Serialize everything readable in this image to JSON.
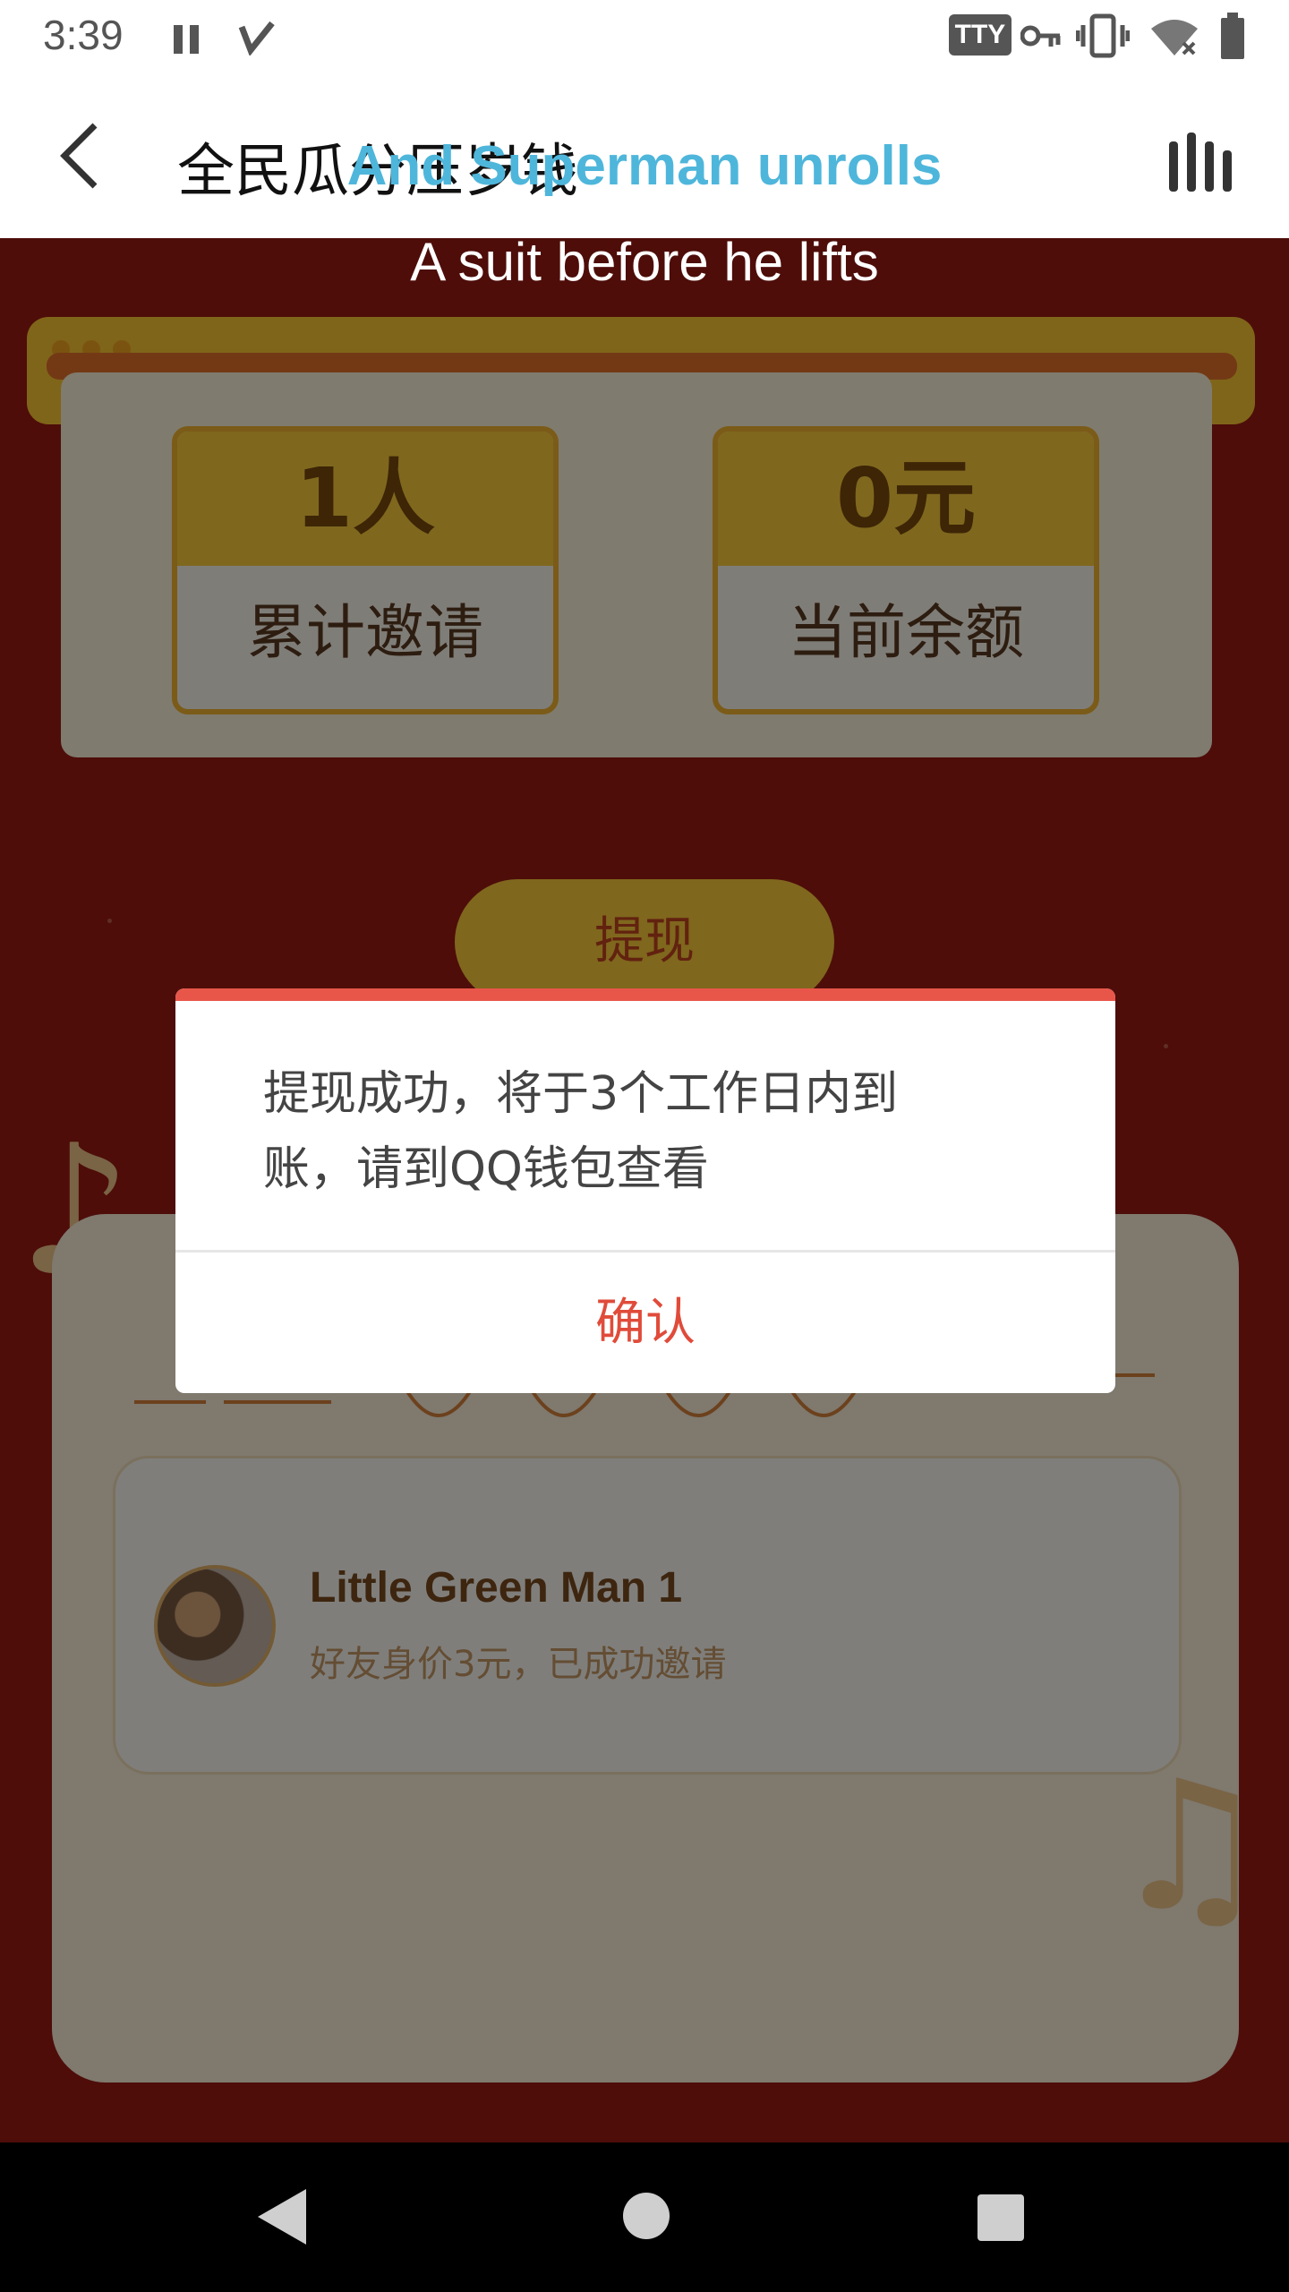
{
  "status_bar": {
    "time": "3:39",
    "tty_label": "TTY",
    "icons": [
      "pause-icon",
      "check-icon",
      "tty-icon",
      "vpn-key-icon",
      "vibrate-icon",
      "wifi-off-icon",
      "battery-icon"
    ]
  },
  "app_bar": {
    "title": "全民瓜分压岁钱",
    "back_icon": "back-chevron-icon",
    "menu_icon": "bars-icon"
  },
  "subtitles": {
    "line1": "And Superman unrolls",
    "line2": "A suit before he lifts"
  },
  "stats": [
    {
      "value": "1人",
      "label": "累计邀请"
    },
    {
      "value": "0元",
      "label": "当前余额"
    }
  ],
  "withdraw_button": "提现",
  "friend": {
    "name": "Little Green Man 1",
    "status": "好友身价3元，已成功邀请"
  },
  "dialog": {
    "message_line1": "提现成功，将于3个工作日内到",
    "message_line2": "账，请到QQ钱包查看",
    "confirm": "确认",
    "accent_color": "#e8564a"
  },
  "colors": {
    "page_red": "#9c1a12",
    "gold": "#ffcf3c",
    "confirm_red": "#e04b3a"
  }
}
